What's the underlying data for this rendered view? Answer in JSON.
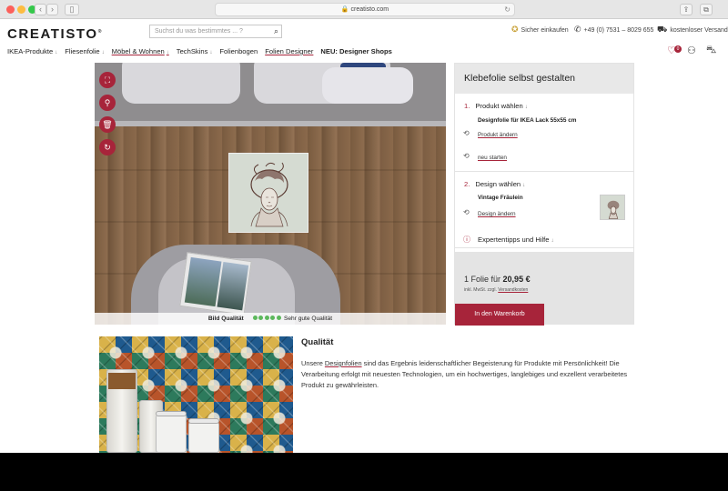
{
  "browser": {
    "url": "creatisto.com",
    "lock_icon": "lock-icon"
  },
  "header": {
    "logo": "CREATISTO",
    "logo_mark": "®",
    "search_placeholder": "Suchst du was bestimmtes ... ?",
    "trust": {
      "secure": "Sicher einkaufen",
      "phone": "+49 (0) 7531 – 8029 655",
      "shipping": "kostenloser Versand"
    },
    "cart_count": "0"
  },
  "nav": {
    "items": [
      {
        "label": "IKEA-Produkte",
        "arrow": "↓"
      },
      {
        "label": "Fliesenfolie",
        "arrow": "↓"
      },
      {
        "label": "Möbel & Wohnen",
        "arrow": "↓"
      },
      {
        "label": "TechSkins",
        "arrow": "↓"
      },
      {
        "label": "Folienbogen",
        "arrow": ""
      },
      {
        "label": "Folien Designer",
        "arrow": ""
      },
      {
        "label": "NEU: Designer Shops",
        "arrow": ""
      }
    ]
  },
  "designer": {
    "quality_label": "Bild Qualität",
    "quality_text": "Sehr gute Qualität",
    "quality_level": 5,
    "quality_max": 5,
    "tools": [
      "fullscreen-icon",
      "zoom-icon",
      "trash-icon",
      "rotate-icon"
    ]
  },
  "panel": {
    "title": "Klebefolie selbst gestalten",
    "step1": {
      "num": "1.",
      "title": "Produkt wählen",
      "arrow": "↓",
      "product": "Designfolie für IKEA Lack 55x55 cm",
      "change": "Produkt ändern",
      "restart": "neu starten"
    },
    "step2": {
      "num": "2.",
      "title": "Design wählen",
      "arrow": "↓",
      "design": "Vintage Fräulein",
      "change": "Design ändern"
    },
    "tips": {
      "title": "Expertentipps und Hilfe",
      "arrow": "↓"
    },
    "price_prefix": "1 Folie für",
    "price": "20,95 €",
    "vat": "inkl. MwSt. zzgl.",
    "shipping_link": "Versandkosten",
    "cart_button": "In den Warenkorb"
  },
  "quality_section": {
    "title": "Qualität",
    "text_pre": "Unsere ",
    "text_link": "Designfolien",
    "text_post": " sind das Ergebnis leidenschaftlicher Begeisterung für Produkte mit Persönlichkeit! Die Verarbeitung erfolgt mit neuesten Technologien, um ein hochwertiges, langlebiges und exzellent verarbeitetes Produkt zu gewährleisten."
  },
  "colors": {
    "accent": "#a7243a",
    "quality_dot": "#5cb85c"
  }
}
